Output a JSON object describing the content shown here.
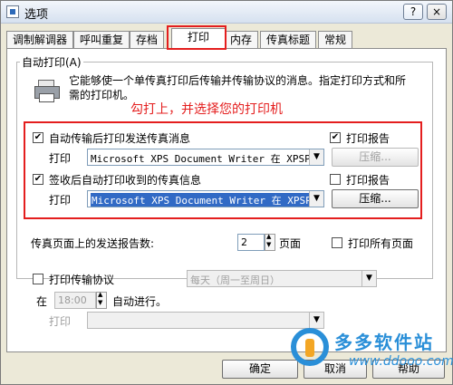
{
  "window": {
    "title": "选项",
    "help_btn": "?",
    "close_btn": "×"
  },
  "tabs": [
    {
      "label": "调制解调器"
    },
    {
      "label": "呼叫重复"
    },
    {
      "label": "存档"
    },
    {
      "label": "打印"
    },
    {
      "label": "内存"
    },
    {
      "label": "传真标题"
    },
    {
      "label": "常规"
    }
  ],
  "auto_print": {
    "group_label": "自动打印(A)",
    "description_line1": "它能够使一个单传真打印后传输并传输协议的消息。指定打印方式和所",
    "description_line2": "需的打印机。",
    "annotation": "勾打上，并选择您的打印机",
    "after_send": {
      "checkbox_label": "自动传输后打印发送传真消息",
      "checked": true,
      "print_label": "打印",
      "printer": "Microsoft XPS Document Writer 在 XPSPort",
      "report_label": "打印报告",
      "report_checked": true,
      "compress_label": "压缩..."
    },
    "after_receive": {
      "checkbox_label": "签收后自动打印收到的传真信息",
      "checked": true,
      "print_label": "打印",
      "printer": "Microsoft XPS Document Writer 在 XPSPort",
      "report_label": "打印报告",
      "report_checked": false,
      "compress_label": "压缩..."
    }
  },
  "report_count": {
    "label": "传真页面上的发送报告数:",
    "value": "2",
    "unit": "页面",
    "print_all_label": "打印所有页面",
    "print_all_checked": false
  },
  "print_protocol": {
    "checkbox_label": "打印传输协议",
    "checked": false,
    "schedule": "每天（周一至周日）",
    "at_label": "在",
    "time": "18:00",
    "auto_label": "自动进行。",
    "print_label": "打印",
    "printer": ""
  },
  "footer": {
    "ok": "确定",
    "cancel": "取消",
    "help": "帮助"
  },
  "watermark": {
    "title": "多多软件站",
    "url": "www.ddooo.com"
  },
  "colors": {
    "highlight_box": "#e41e1e",
    "selection": "#316ac5",
    "window_bg": "#ece9d8"
  }
}
